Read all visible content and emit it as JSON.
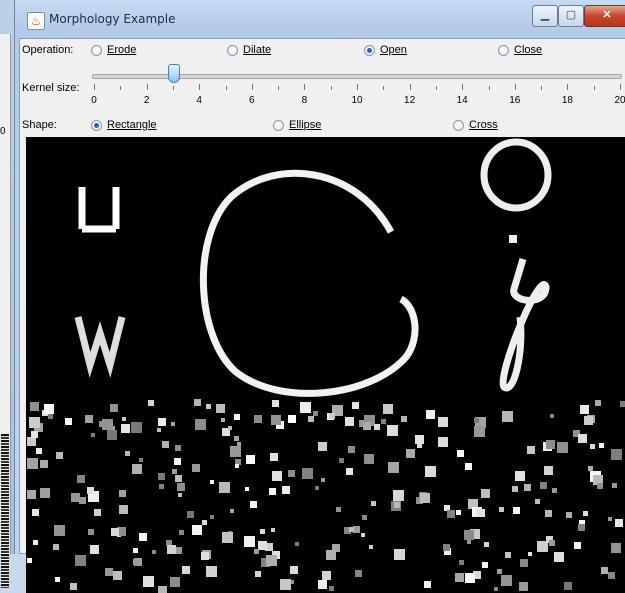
{
  "background_window": {
    "side_label": "0"
  },
  "window": {
    "title": "Morphology Example",
    "icon": "java-cup-icon",
    "controls": {
      "minimize": "minimize-icon",
      "maximize": "maximize-icon",
      "close": "close-icon"
    }
  },
  "operation": {
    "label": "Operation:",
    "options": [
      {
        "label": "Erode",
        "selected": false
      },
      {
        "label": "Dilate",
        "selected": false
      },
      {
        "label": "Open",
        "selected": true
      },
      {
        "label": "Close",
        "selected": false
      }
    ]
  },
  "kernel": {
    "label": "Kernel size:",
    "value": 3,
    "min": 0,
    "max": 20,
    "tick_labels": [
      "0",
      "2",
      "4",
      "6",
      "8",
      "10",
      "12",
      "14",
      "16",
      "18",
      "20"
    ]
  },
  "shape": {
    "label": "Shape:",
    "options": [
      {
        "label": "Rectangle",
        "selected": true
      },
      {
        "label": "Ellipse",
        "selected": false
      },
      {
        "label": "Cross",
        "selected": false
      }
    ]
  },
  "colors": {
    "accent": "#2b62b4",
    "close": "#c8452c",
    "canvas": "#000000"
  }
}
